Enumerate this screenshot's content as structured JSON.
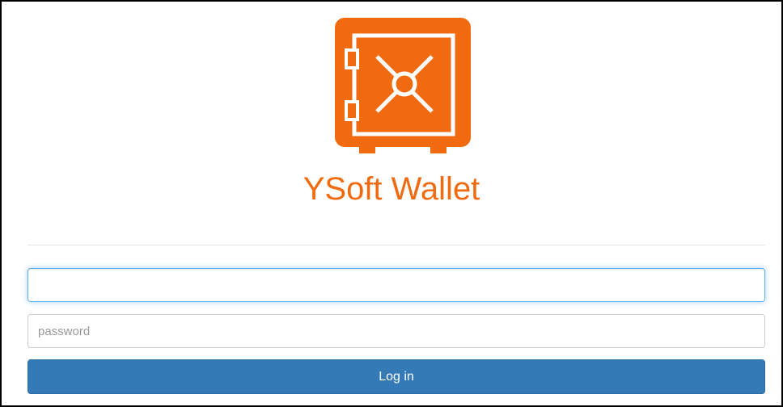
{
  "app": {
    "title": "YSoft Wallet",
    "brand_color": "#f26a0f",
    "logo_icon": "safe-vault-icon"
  },
  "form": {
    "username": {
      "value": "",
      "placeholder": ""
    },
    "password": {
      "value": "",
      "placeholder": "password"
    },
    "login_label": "Log in",
    "login_button_color": "#337ab7"
  }
}
